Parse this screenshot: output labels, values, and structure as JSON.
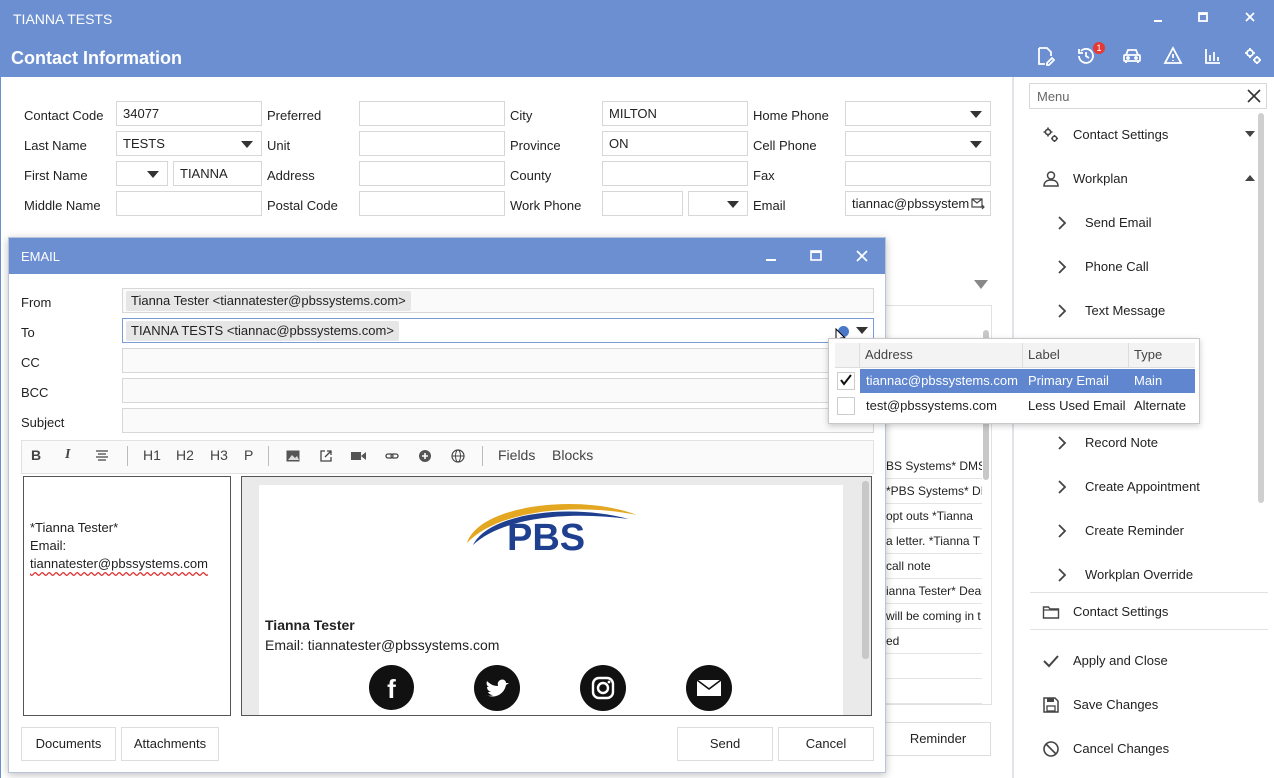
{
  "window": {
    "title": "TIANNA TESTS",
    "header": "Contact Information"
  },
  "header_icons": [
    "edit-document-icon",
    "history-icon",
    "car-icon",
    "warning-icon",
    "bar-chart-icon",
    "settings-gears-icon"
  ],
  "history_badge": "1",
  "contact": {
    "labels": {
      "contact_code": "Contact Code",
      "last_name": "Last Name",
      "first_name": "First Name",
      "middle_name": "Middle Name",
      "preferred": "Preferred",
      "unit": "Unit",
      "address": "Address",
      "postal_code": "Postal Code",
      "city": "City",
      "province": "Province",
      "county": "County",
      "work_phone": "Work Phone",
      "home_phone": "Home Phone",
      "cell_phone": "Cell Phone",
      "fax": "Fax",
      "email": "Email"
    },
    "values": {
      "contact_code": "34077",
      "last_name": "TESTS",
      "first_name": "TIANNA",
      "middle_name": "",
      "preferred": "",
      "unit": "",
      "address": "",
      "postal_code": "",
      "city": "MILTON",
      "province": "ON",
      "county": "",
      "work_phone": "",
      "home_phone": "",
      "cell_phone": "",
      "fax": "",
      "email": "tiannac@pbssystem"
    }
  },
  "background_list": [
    "BS Systems* DMS",
    "*PBS Systems* DM",
    "opt outs  *Tianna",
    "a letter.  *Tianna T",
    "call note",
    "ianna Tester* Deal",
    "will be coming in t",
    "ed",
    "",
    ""
  ],
  "background_button": "Reminder",
  "menu": {
    "placeholder": "Menu",
    "items": [
      {
        "label": "Contact Settings",
        "icon": "gears-icon",
        "kind": "top",
        "caret": "down"
      },
      {
        "label": "Workplan",
        "icon": "user-icon",
        "kind": "top",
        "caret": "up"
      },
      {
        "label": "Send Email",
        "icon": "chevron-right-icon",
        "kind": "sub"
      },
      {
        "label": "Phone Call",
        "icon": "chevron-right-icon",
        "kind": "sub"
      },
      {
        "label": "Text Message",
        "icon": "chevron-right-icon",
        "kind": "sub"
      },
      {
        "label": "Record Note",
        "icon": "chevron-right-icon",
        "kind": "sub"
      },
      {
        "label": "Create Appointment",
        "icon": "chevron-right-icon",
        "kind": "sub"
      },
      {
        "label": "Create Reminder",
        "icon": "chevron-right-icon",
        "kind": "sub"
      },
      {
        "label": "Workplan Override",
        "icon": "chevron-right-icon",
        "kind": "sub"
      },
      {
        "label": "Contact Settings",
        "icon": "folder-icon",
        "kind": "top"
      },
      {
        "label": "Apply and Close",
        "icon": "check-icon",
        "kind": "top"
      },
      {
        "label": "Save Changes",
        "icon": "save-icon",
        "kind": "top"
      },
      {
        "label": "Cancel Changes",
        "icon": "cancel-icon",
        "kind": "top"
      }
    ]
  },
  "email": {
    "title": "EMAIL",
    "labels": {
      "from": "From",
      "to": "To",
      "cc": "CC",
      "bcc": "BCC",
      "subject": "Subject"
    },
    "from": "Tianna Tester <tiannatester@pbssystems.com>",
    "to": "TIANNA TESTS <tiannac@pbssystems.com>",
    "toolbar": {
      "h1": "H1",
      "h2": "H2",
      "h3": "H3",
      "p": "P",
      "fields": "Fields",
      "blocks": "Blocks"
    },
    "source_text": {
      "line1": "*Tianna Tester*",
      "line2": "Email:",
      "line3": "tiannatester@pbssystems.com"
    },
    "preview": {
      "logo": "PBS",
      "name": "Tianna Tester",
      "email_line": "Email: tiannatester@pbssystems.com"
    },
    "social_icons": [
      "facebook-icon",
      "twitter-icon",
      "instagram-icon",
      "mail-icon"
    ],
    "buttons": {
      "documents": "Documents",
      "attachments": "Attachments",
      "send": "Send",
      "cancel": "Cancel"
    }
  },
  "address_popup": {
    "headers": {
      "address": "Address",
      "label": "Label",
      "type": "Type"
    },
    "rows": [
      {
        "checked": true,
        "address": "tiannac@pbssystems.com",
        "label": "Primary Email",
        "type": "Main"
      },
      {
        "checked": false,
        "address": "test@pbssystems.com",
        "label": "Less Used Email",
        "type": "Alternate"
      }
    ]
  },
  "colors": {
    "accent": "#6b8fd0",
    "selected_row": "#5f86cf",
    "badge": "#e53935",
    "logo_blue": "#1f3f8f",
    "logo_gold": "#e3a721"
  }
}
